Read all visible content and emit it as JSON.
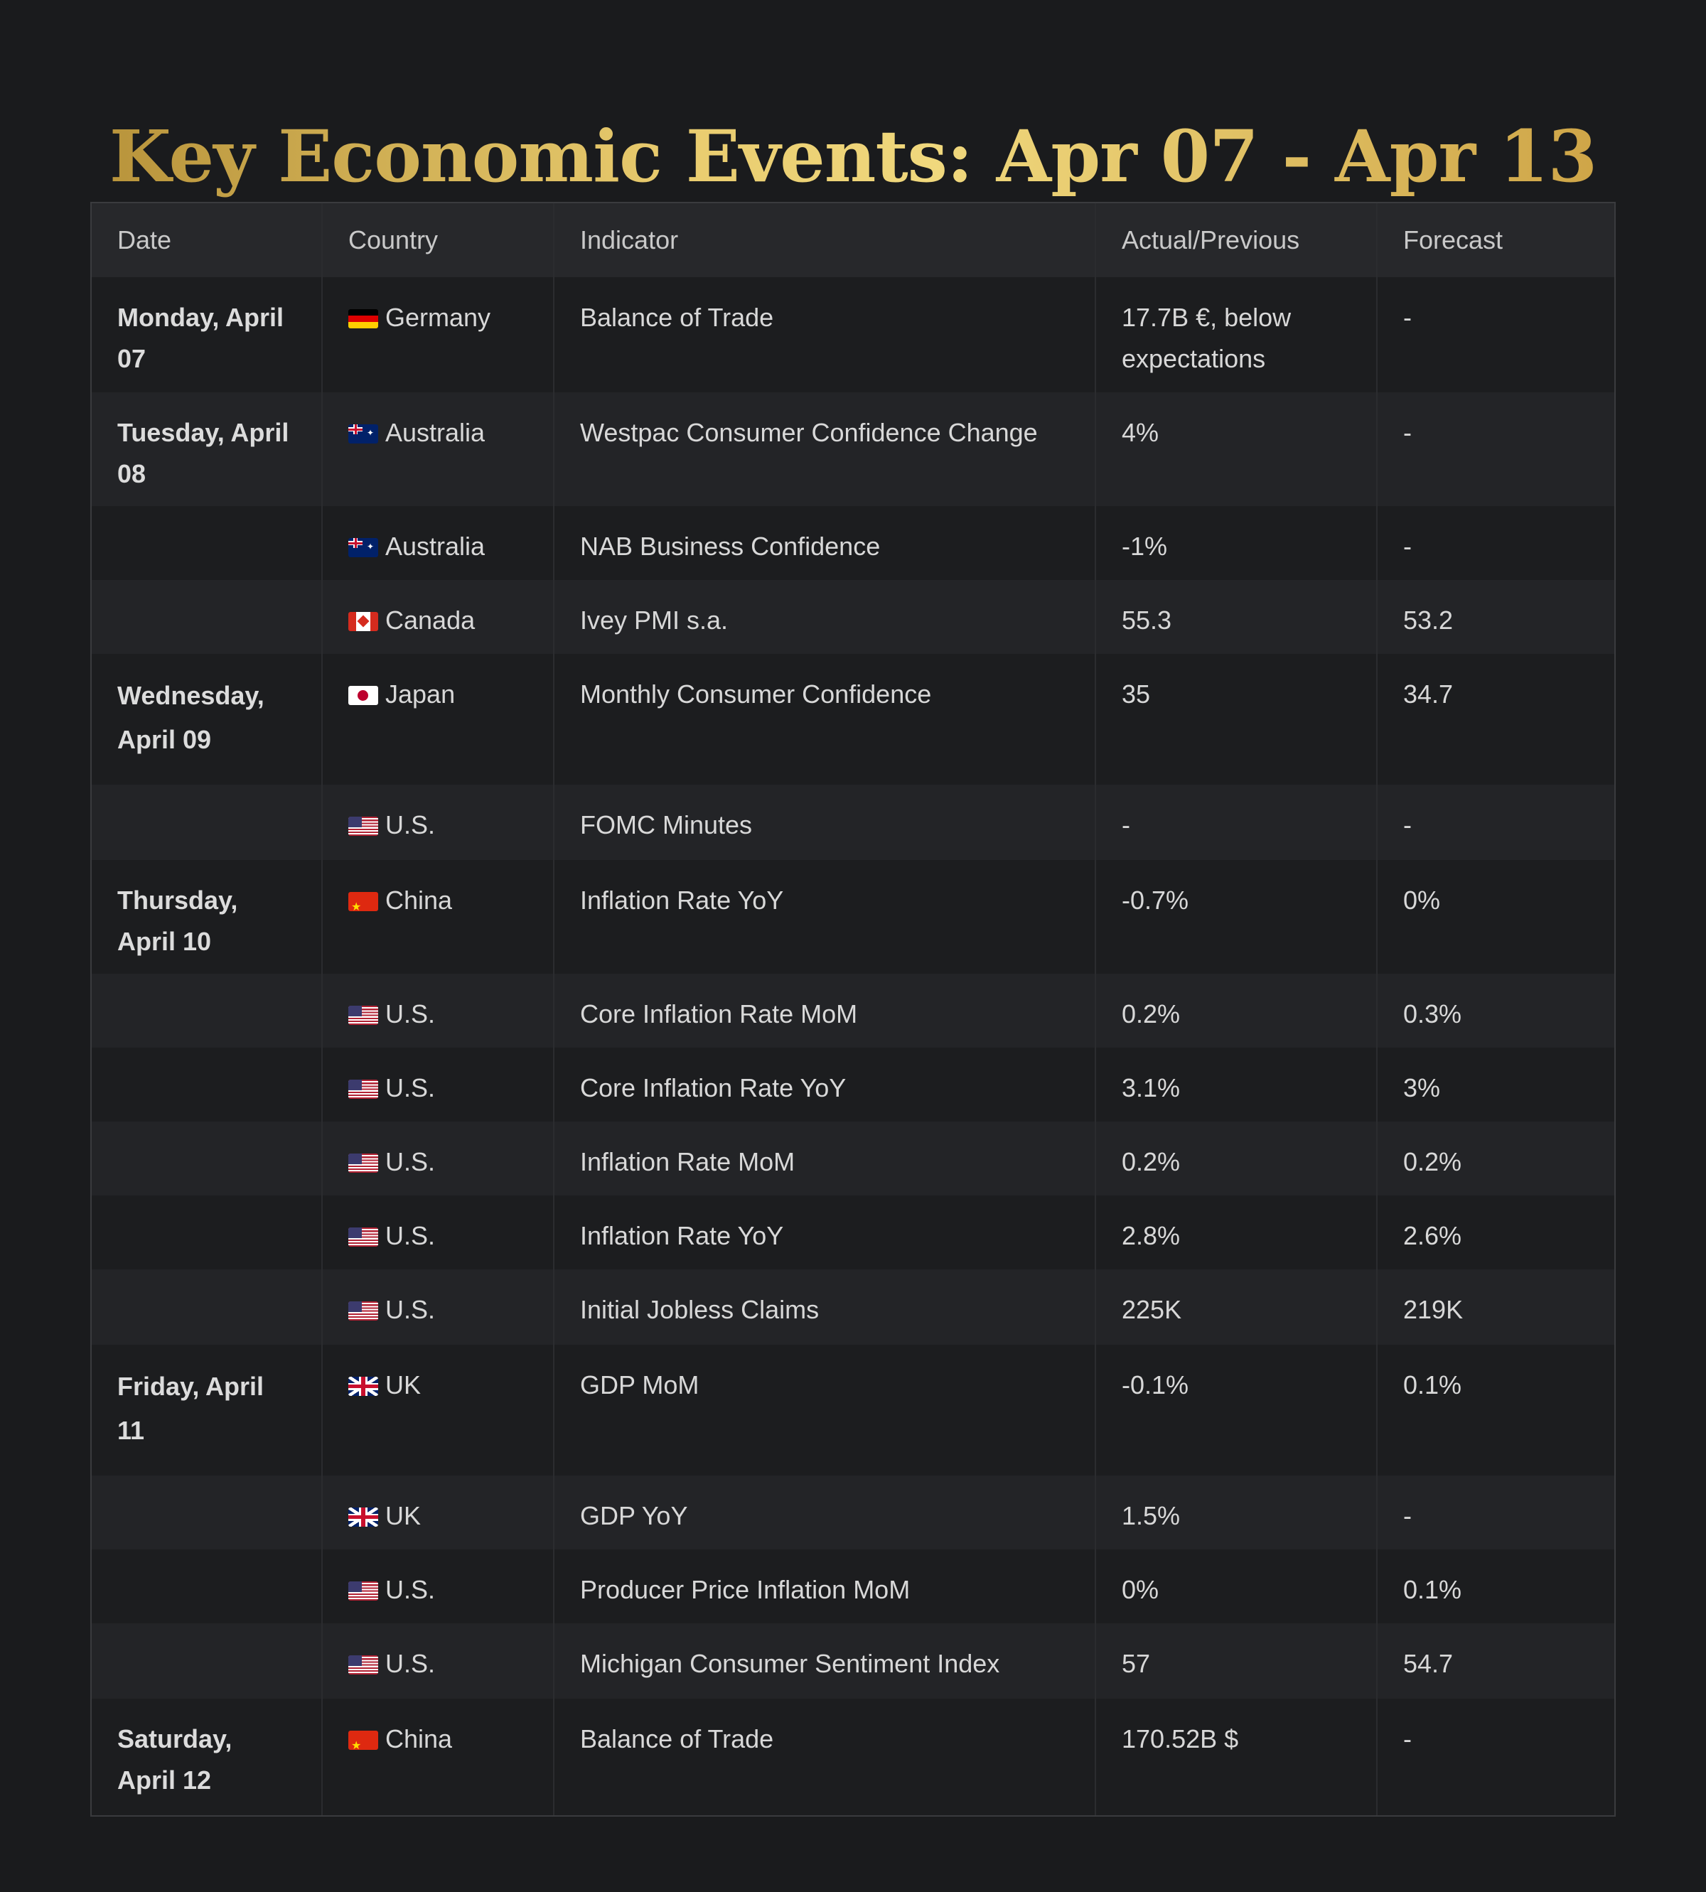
{
  "title": "Key Economic Events: Apr 07 - Apr 13",
  "columns": [
    "Date",
    "Country",
    "Indicator",
    "Actual/Previous",
    "Forecast"
  ],
  "rows": [
    {
      "date": "Monday, April 07",
      "country": "Germany",
      "flag": "germany-flag-icon",
      "indicator": "Balance of Trade",
      "actual": "17.7B €, below expectations",
      "forecast": "-"
    },
    {
      "date": "Tuesday, April 08",
      "country": "Australia",
      "flag": "australia-flag-icon",
      "indicator": "Westpac Consumer Confidence Change",
      "actual": "4%",
      "forecast": "-"
    },
    {
      "date": "",
      "country": "Australia",
      "flag": "australia-flag-icon",
      "indicator": "NAB Business Confidence",
      "actual": "-1%",
      "forecast": "-"
    },
    {
      "date": "",
      "country": "Canada",
      "flag": "canada-flag-icon",
      "indicator": "Ivey PMI s.a.",
      "actual": "55.3",
      "forecast": "53.2"
    },
    {
      "date": "Wednesday, April 09",
      "country": "Japan",
      "flag": "japan-flag-icon",
      "indicator": "Monthly Consumer Confidence",
      "actual": "35",
      "forecast": "34.7"
    },
    {
      "date": "",
      "country": "U.S.",
      "flag": "us-flag-icon",
      "indicator": "FOMC Minutes",
      "actual": "-",
      "forecast": "-"
    },
    {
      "date": "Thursday, April 10",
      "country": "China",
      "flag": "china-flag-icon",
      "indicator": "Inflation Rate YoY",
      "actual": "-0.7%",
      "forecast": "0%"
    },
    {
      "date": "",
      "country": "U.S.",
      "flag": "us-flag-icon",
      "indicator": "Core Inflation Rate MoM",
      "actual": "0.2%",
      "forecast": "0.3%"
    },
    {
      "date": "",
      "country": "U.S.",
      "flag": "us-flag-icon",
      "indicator": "Core Inflation Rate YoY",
      "actual": "3.1%",
      "forecast": "3%"
    },
    {
      "date": "",
      "country": "U.S.",
      "flag": "us-flag-icon",
      "indicator": "Inflation Rate MoM",
      "actual": "0.2%",
      "forecast": "0.2%"
    },
    {
      "date": "",
      "country": "U.S.",
      "flag": "us-flag-icon",
      "indicator": "Inflation Rate YoY",
      "actual": "2.8%",
      "forecast": "2.6%"
    },
    {
      "date": "",
      "country": "U.S.",
      "flag": "us-flag-icon",
      "indicator": "Initial Jobless Claims",
      "actual": "225K",
      "forecast": "219K"
    },
    {
      "date": "Friday, April 11",
      "country": "UK",
      "flag": "uk-flag-icon",
      "indicator": "GDP MoM",
      "actual": "-0.1%",
      "forecast": "0.1%"
    },
    {
      "date": "",
      "country": "UK",
      "flag": "uk-flag-icon",
      "indicator": "GDP YoY",
      "actual": "1.5%",
      "forecast": "-"
    },
    {
      "date": "",
      "country": "U.S.",
      "flag": "us-flag-icon",
      "indicator": "Producer Price Inflation MoM",
      "actual": "0%",
      "forecast": "0.1%"
    },
    {
      "date": "",
      "country": "U.S.",
      "flag": "us-flag-icon",
      "indicator": "Michigan Consumer Sentiment Index",
      "actual": "57",
      "forecast": "54.7"
    },
    {
      "date": "Saturday, April 12",
      "country": "China",
      "flag": "china-flag-icon",
      "indicator": "Balance of Trade",
      "actual": "170.52B $",
      "forecast": "-"
    }
  ],
  "colors": {
    "background": "#1a1b1d",
    "title_gold": "#e0bd5a",
    "header_bg": "#27282b",
    "row_odd": "#1c1d1f",
    "row_even": "#232427"
  }
}
